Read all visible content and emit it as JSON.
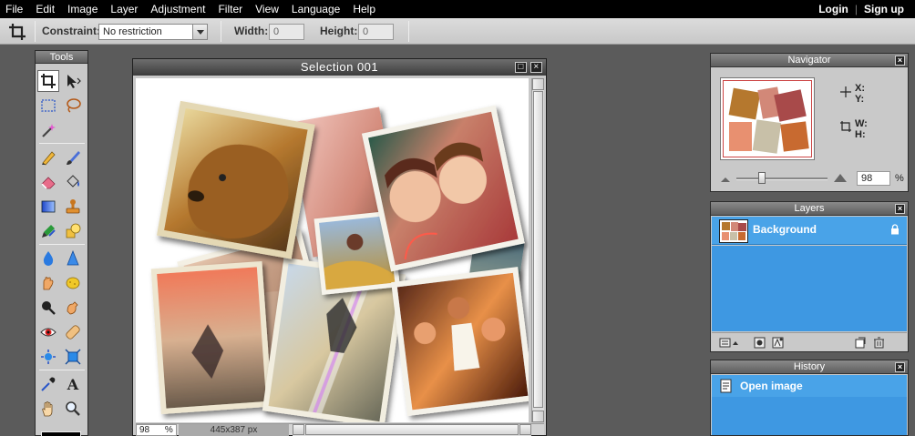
{
  "menubar": {
    "items": [
      "File",
      "Edit",
      "Image",
      "Layer",
      "Adjustment",
      "Filter",
      "View",
      "Language",
      "Help"
    ],
    "login": "Login",
    "signup": "Sign up"
  },
  "options": {
    "constraint_label": "Constraint:",
    "constraint_value": "No restriction",
    "width_label": "Width:",
    "width_value": "0",
    "height_label": "Height:",
    "height_value": "0"
  },
  "tools": {
    "title": "Tools",
    "icons": [
      "crop-icon",
      "move-icon",
      "marquee-icon",
      "lasso-icon",
      "magic-wand-icon",
      "pencil-icon",
      "brush-icon",
      "eraser-icon",
      "bucket-icon",
      "gradient-icon",
      "stamp-icon",
      "color-replace-icon",
      "shape-icon",
      "drop-icon",
      "sharpen-icon",
      "smudge-icon",
      "sponge-icon",
      "dodge-icon",
      "burn-icon",
      "red-eye-icon",
      "spot-heal-icon",
      "bloat-icon",
      "pinch-icon",
      "eyedropper-icon",
      "type-icon",
      "hand-icon",
      "zoom-icon"
    ]
  },
  "document": {
    "title": "Selection  001",
    "zoom": "98",
    "zoom_unit": "%",
    "dimensions": "445x387 px"
  },
  "navigator": {
    "title": "Navigator",
    "x_label": "X:",
    "y_label": "Y:",
    "w_label": "W:",
    "h_label": "H:",
    "zoom": "98",
    "zoom_unit": "%"
  },
  "layers": {
    "title": "Layers",
    "items": [
      {
        "name": "Background",
        "locked": true
      }
    ]
  },
  "history": {
    "title": "History",
    "items": [
      {
        "name": "Open image"
      }
    ]
  },
  "colors": {
    "selection_blue": "#49a3e8",
    "panel_gray": "#c9c9c9",
    "workspace": "#5b5b5b"
  }
}
